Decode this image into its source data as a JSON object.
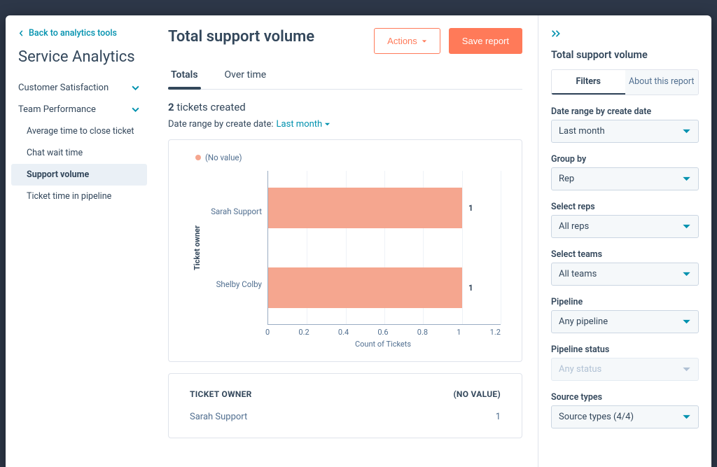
{
  "sidebar": {
    "back": "Back to analytics tools",
    "title": "Service Analytics",
    "sections": {
      "cs": "Customer Satisfaction",
      "tp": "Team Performance"
    },
    "items": {
      "avg_close": "Average time to close ticket",
      "chat_wait": "Chat wait time",
      "support_vol": "Support volume",
      "ticket_pipe": "Ticket time in pipeline"
    }
  },
  "header": {
    "title": "Total support volume",
    "actions": "Actions",
    "save": "Save report"
  },
  "tabs": {
    "totals": "Totals",
    "over_time": "Over time"
  },
  "summary": {
    "count": "2",
    "count_suffix": " tickets created"
  },
  "daterange": {
    "label": "Date range by create date:",
    "value": "Last month"
  },
  "legend": {
    "novalue": "(No value)"
  },
  "chart_data": {
    "type": "bar",
    "orientation": "horizontal",
    "categories": [
      "Sarah Support",
      "Shelby Colby"
    ],
    "values": [
      1,
      1
    ],
    "ylabel": "Ticket owner",
    "xlabel": "Count of Tickets",
    "xlim": [
      0,
      1.2
    ],
    "xticks": [
      "0",
      "0.2",
      "0.4",
      "0.6",
      "0.8",
      "1",
      "1.2"
    ],
    "series_name": "(No value)"
  },
  "table": {
    "cols": {
      "owner": "Ticket Owner",
      "novalue": "(No value)"
    },
    "rows": [
      {
        "owner": "Sarah Support",
        "novalue": "1"
      }
    ]
  },
  "rp": {
    "title": "Total support volume",
    "tabs": {
      "filters": "Filters",
      "about": "About this report"
    },
    "filters": {
      "daterange": {
        "label": "Date range by create date",
        "value": "Last month"
      },
      "groupby": {
        "label": "Group by",
        "value": "Rep"
      },
      "reps": {
        "label": "Select reps",
        "value": "All reps"
      },
      "teams": {
        "label": "Select teams",
        "value": "All teams"
      },
      "pipeline": {
        "label": "Pipeline",
        "value": "Any pipeline"
      },
      "pstatus": {
        "label": "Pipeline status",
        "value": "Any status"
      },
      "sourcetypes": {
        "label": "Source types",
        "value": "Source types (4/4)"
      }
    }
  }
}
